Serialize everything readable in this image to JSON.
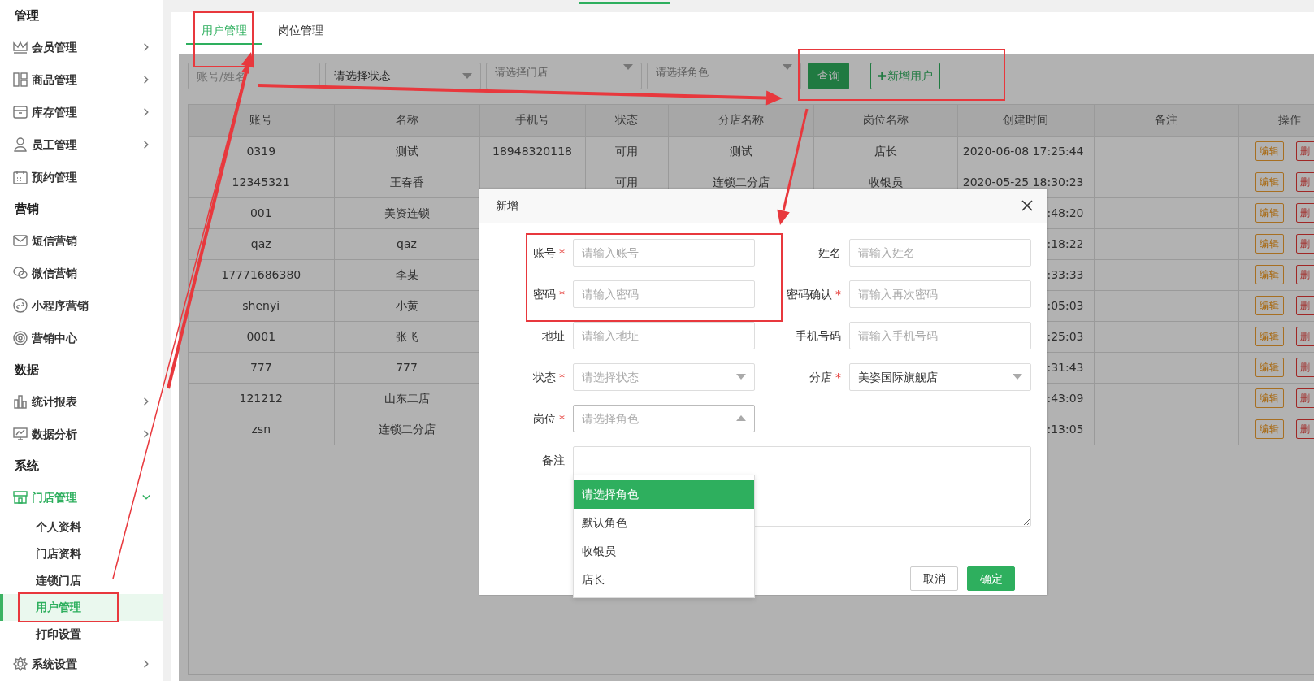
{
  "sidebar": {
    "sections": [
      {
        "title": "管理",
        "items": [
          {
            "label": "会员管理",
            "selected": false,
            "expanded": false
          },
          {
            "label": "商品管理",
            "selected": false,
            "expanded": false
          },
          {
            "label": "库存管理",
            "selected": false,
            "expanded": false
          },
          {
            "label": "员工管理",
            "selected": false,
            "expanded": false
          },
          {
            "label": "预约管理",
            "selected": false
          }
        ]
      },
      {
        "title": "营销",
        "items": [
          {
            "label": "短信营销",
            "selected": false
          },
          {
            "label": "微信营销",
            "selected": false
          },
          {
            "label": "小程序营销",
            "selected": false
          },
          {
            "label": "营销中心",
            "selected": false
          }
        ]
      },
      {
        "title": "数据",
        "items": [
          {
            "label": "统计报表",
            "selected": false,
            "expanded": false
          },
          {
            "label": "数据分析",
            "selected": false,
            "expanded": false
          }
        ]
      },
      {
        "title": "系统",
        "items": [
          {
            "label": "门店管理",
            "selected": true,
            "expanded": true,
            "children": [
              {
                "label": "个人资料",
                "selected": false
              },
              {
                "label": "门店资料",
                "selected": false
              },
              {
                "label": "连锁门店",
                "selected": false
              },
              {
                "label": "用户管理",
                "selected": true
              },
              {
                "label": "打印设置",
                "selected": false
              }
            ]
          },
          {
            "label": "系统设置",
            "selected": false,
            "expanded": false
          }
        ]
      }
    ]
  },
  "tabs": [
    {
      "label": "用户管理",
      "selected": true
    },
    {
      "label": "岗位管理",
      "selected": false
    }
  ],
  "filters": [
    {
      "kind": "input",
      "placeholder": "账号/姓名"
    },
    {
      "kind": "select",
      "value": "请选择状态"
    },
    {
      "kind": "select",
      "placeholder": "请选择门店"
    },
    {
      "kind": "select",
      "placeholder": "请选择角色"
    }
  ],
  "toolbar_buttons": [
    {
      "kind": "primary",
      "label": "查询"
    },
    {
      "kind": "outline",
      "label": "新增用户"
    }
  ],
  "table": {
    "columns": [
      "账号",
      "名称",
      "手机号",
      "状态",
      "分店名称",
      "岗位名称",
      "创建时间",
      "备注",
      "操作"
    ],
    "rows": [
      {
        "account": "0319",
        "name": "测试",
        "phone": "18948320118",
        "status": "可用",
        "branch": "测试",
        "role": "店长",
        "created": "2020-06-08 17:25:44",
        "actions": [
          {
            "kind": "edit",
            "label": "编辑"
          },
          {
            "kind": "delete",
            "label": "删"
          }
        ]
      },
      {
        "account": "12345321",
        "name": "王春香",
        "status": "可用",
        "branch": "连锁二分店",
        "role": "收银员",
        "created": "2020-05-25 18:30:23",
        "actions": [
          {
            "kind": "edit",
            "label": "编辑"
          },
          {
            "kind": "delete",
            "label": "删"
          }
        ]
      },
      {
        "account": "001",
        "name": "美资连锁",
        "created": ":48:20",
        "actions": [
          {
            "kind": "edit",
            "label": "编辑"
          },
          {
            "kind": "delete",
            "label": "删"
          }
        ]
      },
      {
        "account": "qaz",
        "name": "qaz",
        "created": ":18:22",
        "actions": [
          {
            "kind": "edit",
            "label": "编辑"
          },
          {
            "kind": "delete",
            "label": "删"
          }
        ]
      },
      {
        "account": "17771686380",
        "name": "李某",
        "created": ":33:33",
        "actions": [
          {
            "kind": "edit",
            "label": "编辑"
          },
          {
            "kind": "delete",
            "label": "删"
          }
        ]
      },
      {
        "account": "shenyi",
        "name": "小黄",
        "created": ":05:03",
        "actions": [
          {
            "kind": "edit",
            "label": "编辑"
          },
          {
            "kind": "delete",
            "label": "删"
          }
        ]
      },
      {
        "account": "0001",
        "name": "张飞",
        "created": ":25:03",
        "actions": [
          {
            "kind": "edit",
            "label": "编辑"
          },
          {
            "kind": "delete",
            "label": "删"
          }
        ]
      },
      {
        "account": "777",
        "name": "777",
        "created": ":31:43",
        "actions": [
          {
            "kind": "edit",
            "label": "编辑"
          },
          {
            "kind": "delete",
            "label": "删"
          }
        ]
      },
      {
        "account": "121212",
        "name": "山东二店",
        "created": ":43:09",
        "actions": [
          {
            "kind": "edit",
            "label": "编辑"
          },
          {
            "kind": "delete",
            "label": "删"
          }
        ]
      },
      {
        "account": "zsn",
        "name": "连锁二分店",
        "created": ":13:05",
        "actions": [
          {
            "kind": "edit",
            "label": "编辑"
          },
          {
            "kind": "delete",
            "label": "删"
          }
        ]
      }
    ]
  },
  "dialog": {
    "title": "新增",
    "fields": [
      {
        "kind": "input",
        "label": "账号",
        "required_mark": "*",
        "placeholder": "请输入账号"
      },
      {
        "kind": "input",
        "label": "姓名",
        "placeholder": "请输入姓名"
      },
      {
        "kind": "input",
        "label": "密码",
        "required_mark": "*",
        "placeholder": "请输入密码"
      },
      {
        "kind": "input",
        "label": "密码确认",
        "required_mark": "*",
        "placeholder": "请输入再次密码"
      },
      {
        "kind": "input",
        "label": "地址",
        "placeholder": "请输入地址"
      },
      {
        "kind": "input",
        "label": "手机号码",
        "placeholder": "请输入手机号码"
      },
      {
        "kind": "select",
        "label": "状态",
        "required_mark": "*",
        "placeholder": "请选择状态",
        "expanded": false
      },
      {
        "kind": "select",
        "label": "分店",
        "required_mark": "*",
        "value": "美姿国际旗舰店",
        "expanded": false
      },
      {
        "kind": "select",
        "label": "岗位",
        "required_mark": "*",
        "placeholder": "请选择角色",
        "expanded": true,
        "options": [
          {
            "label": "请选择角色",
            "selected": true
          },
          {
            "label": "默认角色",
            "selected": false
          },
          {
            "label": "收银员",
            "selected": false
          },
          {
            "label": "店长",
            "selected": false
          }
        ]
      },
      {
        "kind": "textarea",
        "label": "备注"
      }
    ],
    "buttons": [
      {
        "kind": "secondary",
        "label": "取消"
      },
      {
        "kind": "primary",
        "label": "确定"
      }
    ]
  }
}
